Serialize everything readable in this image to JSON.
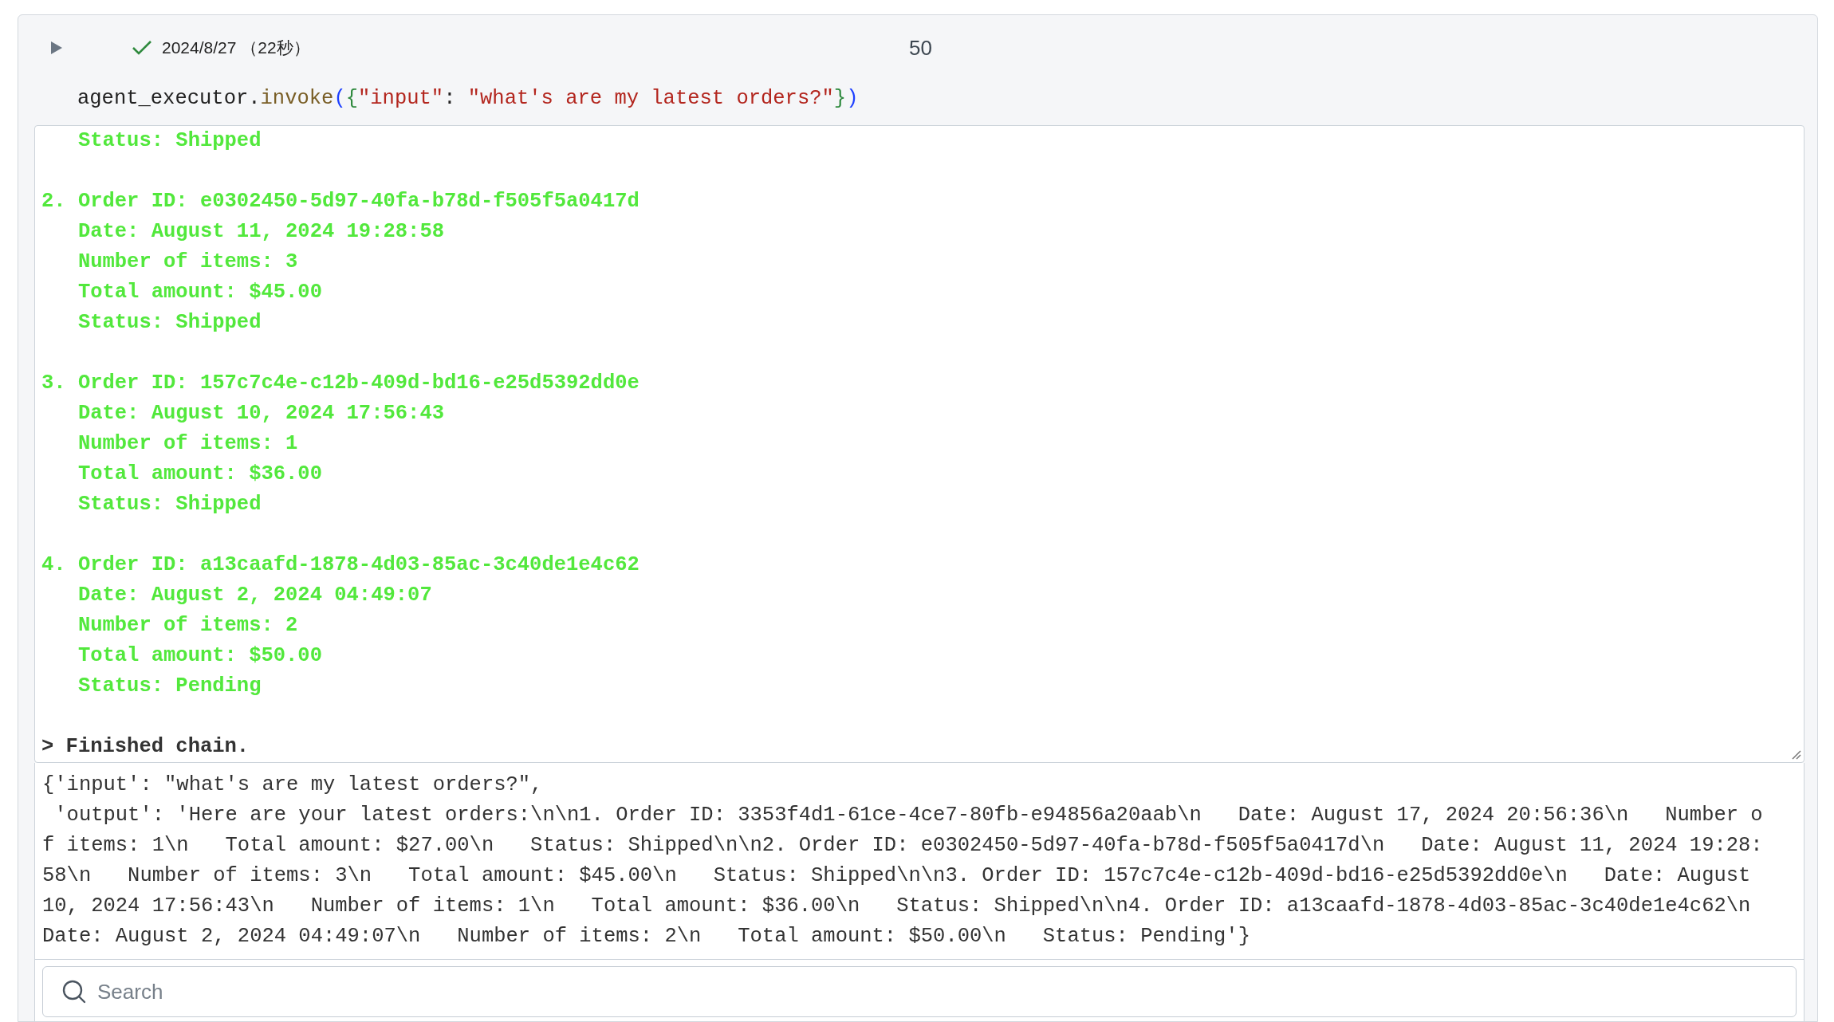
{
  "cell": {
    "execution": {
      "succeeded": true,
      "timestamp": "2024/8/27",
      "duration": "（22秒）"
    },
    "execution_count": "50",
    "code": [
      {
        "kind": "name",
        "text": "agent_executor"
      },
      {
        "kind": "name",
        "text": "."
      },
      {
        "kind": "function",
        "text": "invoke"
      },
      {
        "kind": "paren",
        "text": "("
      },
      {
        "kind": "brace",
        "text": "{"
      },
      {
        "kind": "string",
        "text": "\"input\""
      },
      {
        "kind": "name",
        "text": ": "
      },
      {
        "kind": "string",
        "text": "\"what's are my latest orders?\""
      },
      {
        "kind": "brace",
        "text": "}"
      },
      {
        "kind": "paren",
        "text": ")"
      }
    ],
    "stream": {
      "blocks": [
        [
          "   Status: Shipped"
        ],
        [
          "2. Order ID: e0302450-5d97-40fa-b78d-f505f5a0417d",
          "   Date: August 11, 2024 19:28:58",
          "   Number of items: 3",
          "   Total amount: $45.00",
          "   Status: Shipped"
        ],
        [
          "3. Order ID: 157c7c4e-c12b-409d-bd16-e25d5392dd0e",
          "   Date: August 10, 2024 17:56:43",
          "   Number of items: 1",
          "   Total amount: $36.00",
          "   Status: Shipped"
        ],
        [
          "4. Order ID: a13caafd-1878-4d03-85ac-3c40de1e4c62",
          "   Date: August 2, 2024 04:49:07",
          "   Number of items: 2",
          "   Total amount: $50.00",
          "   Status: Pending"
        ]
      ],
      "finished": "> Finished chain."
    },
    "result_lines": [
      "{'input': \"what's are my latest orders?\",",
      " 'output': 'Here are your latest orders:\\n\\n1. Order ID: 3353f4d1-61ce-4ce7-80fb-e94856a20aab\\n   Date: August 17, 2024 20:56:36\\n   Number o",
      "f items: 1\\n   Total amount: $27.00\\n   Status: Shipped\\n\\n2. Order ID: e0302450-5d97-40fa-b78d-f505f5a0417d\\n   Date: August 11, 2024 19:28:",
      "58\\n   Number of items: 3\\n   Total amount: $45.00\\n   Status: Shipped\\n\\n3. Order ID: 157c7c4e-c12b-409d-bd16-e25d5392dd0e\\n   Date: August",
      "10, 2024 17:56:43\\n   Number of items: 1\\n   Total amount: $36.00\\n   Status: Shipped\\n\\n4. Order ID: a13caafd-1878-4d03-85ac-3c40de1e4c62\\n",
      "Date: August 2, 2024 04:49:07\\n   Number of items: 2\\n   Total amount: $50.00\\n   Status: Pending'}"
    ]
  },
  "search": {
    "placeholder": "Search"
  }
}
